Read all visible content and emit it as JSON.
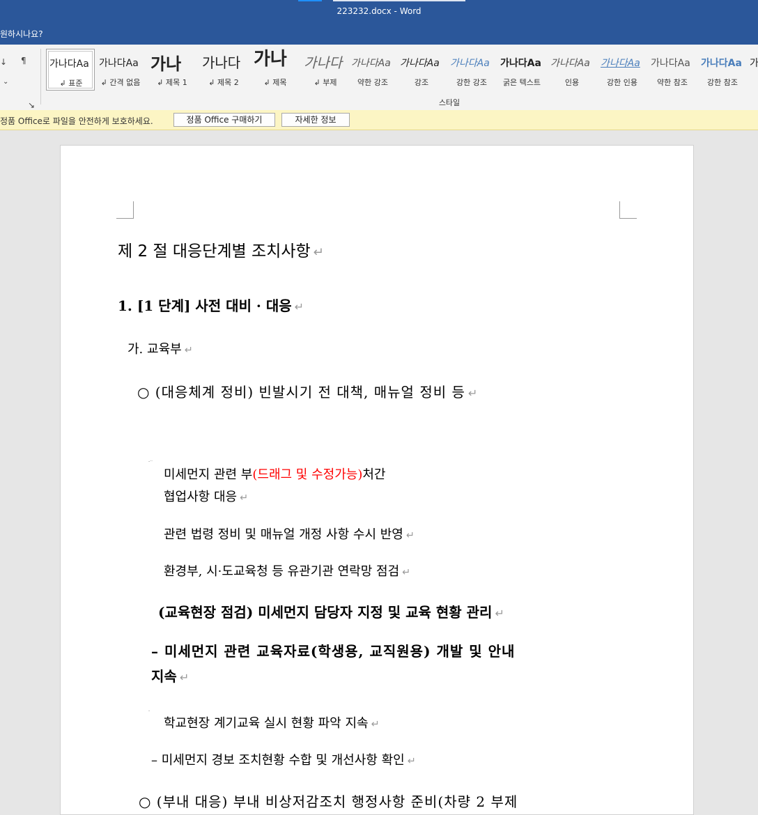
{
  "window": {
    "title": "223232.docx  -  Word"
  },
  "tell_me": "원하시나요?",
  "ribbon": {
    "group_label": "스타일",
    "styles": [
      {
        "preview": "가나다Aa",
        "label": "↲ 표준"
      },
      {
        "preview": "가나다Aa",
        "label": "↲ 간격 없음"
      },
      {
        "preview": "가나",
        "label": "↲ 제목 1"
      },
      {
        "preview": "가나다",
        "label": "↲ 제목 2"
      },
      {
        "preview": "가나",
        "label": "↲ 제목"
      },
      {
        "preview": "가나다",
        "label": "↲ 부제"
      },
      {
        "preview": "가나다Aa",
        "label": "약한 강조"
      },
      {
        "preview": "가나다Aa",
        "label": "강조"
      },
      {
        "preview": "가나다Aa",
        "label": "강한 강조"
      },
      {
        "preview": "가나다Aa",
        "label": "굵은 텍스트"
      },
      {
        "preview": "가나다Aa",
        "label": "인용"
      },
      {
        "preview": "가나다Aa",
        "label": "강한 인용"
      },
      {
        "preview": "가나다Aa",
        "label": "약한 참조"
      },
      {
        "preview": "가나다Aa",
        "label": "강한 참조"
      },
      {
        "preview": "가",
        "label": ""
      }
    ]
  },
  "infobar": {
    "message": "정품 Office로 파일을 안전하게 보호하세요.",
    "buy_button": "정품 Office 구매하기",
    "info_button": "자세한 정보"
  },
  "document": {
    "para_mark": "↵",
    "section_title": "제 2 절 대응단계별 조치사항",
    "heading1": "1. [1 단계] 사전 대비 · 대응",
    "sub_ga": "가. 교육부",
    "bullet1": "○ (대응체계 정비) 빈발시기 전 대책, 매뉴얼 정비 등",
    "item1_pre": "미세먼지 관련 부",
    "item1_red": "(드래그 및 수정가능)",
    "item1_post": "처간",
    "item1_line2": "협업사항 대응",
    "item2": "관련 법령 정비 및 매뉴얼 개정 사항 수시 반영",
    "item3": "환경부, 시·도교육청 등 유관기관 연락망 점검",
    "bullet2": "(교육현장 점검) 미세먼지 담당자 지정 및 교육 현황 관리",
    "dash1_line1": "–  미세먼지 관련 교육자료(학생용, 교직원용) 개발 및 안내",
    "dash1_line2": "지속",
    "item4": "학교현장 계기교육 실시 현황 파악 지속",
    "dash2": "– 미세먼지 경보 조치현황 수합 및 개선사항 확인",
    "bullet3": "○ (부내 대응) 부내 비상저감조치 행정사항 준비(차량 2 부제"
  }
}
